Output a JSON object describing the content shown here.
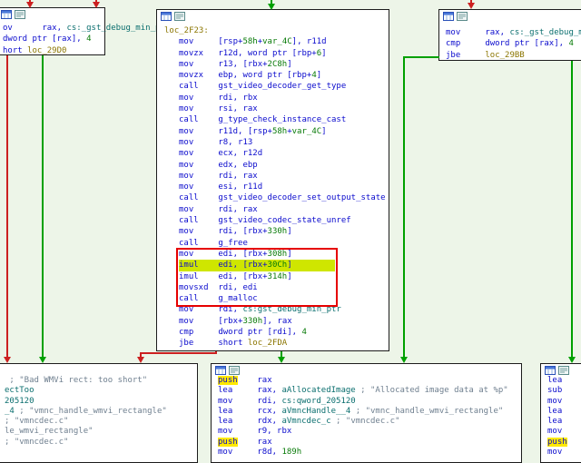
{
  "app": "disassembler-graph-view",
  "colors": {
    "canvas_bg": "#edf5e8",
    "node_bg": "#ffffff",
    "node_border": "#1c1c1c",
    "code_blue": "#0b0bcd",
    "number_green": "#087a08",
    "dataref_teal": "#0a6e6e",
    "loc_label_olive": "#8b7500",
    "comment_slate": "#708090",
    "edge_green": "#00a000",
    "edge_red": "#cc2020",
    "highlight_box_red": "#e60000",
    "highlight_line_lime": "#cfe600",
    "highlight_word_yellow": "#ffe900"
  },
  "blocks": {
    "top_left": {
      "lines": [
        [
          [
            "b",
            "ov      rax, "
          ],
          [
            "d",
            "cs:_gst_debug_min_ptr"
          ]
        ],
        [
          [
            "b",
            "dword ptr [rax], "
          ],
          [
            "n",
            "4"
          ]
        ],
        [
          [
            "b",
            "hort "
          ],
          [
            "l",
            "loc_29D0"
          ]
        ]
      ]
    },
    "center": {
      "lines": [
        {
          "cls": "label",
          "segs": [
            [
              "l",
              "loc_2F23:"
            ]
          ]
        },
        [
          [
            "b",
            "mov     [rsp+"
          ],
          [
            "n",
            "58h"
          ],
          [
            "b",
            "+"
          ],
          [
            "n",
            "var_4C"
          ],
          [
            "b",
            "], r11d"
          ]
        ],
        [
          [
            "b",
            "movzx   r12d, word ptr [rbp+"
          ],
          [
            "n",
            "6"
          ],
          [
            "b",
            "]"
          ]
        ],
        [
          [
            "b",
            "mov     r13, [rbx+"
          ],
          [
            "n",
            "2C8h"
          ],
          [
            "b",
            "]"
          ]
        ],
        [
          [
            "b",
            "movzx   ebp, word ptr [rbp+"
          ],
          [
            "n",
            "4"
          ],
          [
            "b",
            "]"
          ]
        ],
        [
          [
            "b",
            "call    "
          ],
          [
            "f",
            "gst_video_decoder_get_type"
          ]
        ],
        [
          [
            "b",
            "mov     rdi, rbx"
          ]
        ],
        [
          [
            "b",
            "mov     rsi, rax"
          ]
        ],
        [
          [
            "b",
            "call    "
          ],
          [
            "f",
            "g_type_check_instance_cast"
          ]
        ],
        [
          [
            "b",
            "mov     r11d, [rsp+"
          ],
          [
            "n",
            "58h"
          ],
          [
            "b",
            "+"
          ],
          [
            "n",
            "var_4C"
          ],
          [
            "b",
            "]"
          ]
        ],
        [
          [
            "b",
            "mov     r8, r13"
          ]
        ],
        [
          [
            "b",
            "mov     ecx, r12d"
          ]
        ],
        [
          [
            "b",
            "mov     edx, ebp"
          ]
        ],
        [
          [
            "b",
            "mov     rdi, rax"
          ]
        ],
        [
          [
            "b",
            "mov     esi, r11d"
          ]
        ],
        [
          [
            "b",
            "call    "
          ],
          [
            "f",
            "gst_video_decoder_set_output_state"
          ]
        ],
        [
          [
            "b",
            "mov     rdi, rax"
          ]
        ],
        [
          [
            "b",
            "call    "
          ],
          [
            "f",
            "gst_video_codec_state_unref"
          ]
        ],
        [
          [
            "b",
            "mov     rdi, [rbx+"
          ],
          [
            "n",
            "330h"
          ],
          [
            "b",
            "]"
          ]
        ],
        [
          [
            "b",
            "call    "
          ],
          [
            "f",
            "g_free"
          ]
        ],
        [
          [
            "b",
            "mov     edi, [rbx+"
          ],
          [
            "n",
            "308h"
          ],
          [
            "b",
            "]"
          ]
        ],
        {
          "cls": "lime",
          "segs": [
            [
              "b",
              "imul    edi, [rbx+"
            ],
            [
              "n",
              "30Ch"
            ],
            [
              "b",
              "]"
            ]
          ]
        },
        [
          [
            "b",
            "imul    edi, [rbx+"
          ],
          [
            "n",
            "314h"
          ],
          [
            "b",
            "]"
          ]
        ],
        [
          [
            "b",
            "movsxd  rdi, edi"
          ]
        ],
        [
          [
            "b",
            "call    "
          ],
          [
            "f",
            "g_malloc"
          ]
        ],
        [
          [
            "b",
            "mov     rdi, "
          ],
          [
            "d",
            "cs:gst_debug_min_ptr"
          ]
        ],
        [
          [
            "b",
            "mov     [rbx+"
          ],
          [
            "n",
            "330h"
          ],
          [
            "b",
            "], rax"
          ]
        ],
        [
          [
            "b",
            "cmp     dword ptr [rdi], "
          ],
          [
            "n",
            "4"
          ]
        ],
        [
          [
            "b",
            "jbe     short "
          ],
          [
            "l",
            "loc_2FDA"
          ]
        ]
      ]
    },
    "top_right": {
      "lines": [
        [
          [
            "b",
            "mov     rax, "
          ],
          [
            "d",
            "cs:_gst_debug_min_ptr"
          ]
        ],
        [
          [
            "b",
            "cmp     dword ptr [rax], "
          ],
          [
            "n",
            "4"
          ]
        ],
        [
          [
            "b",
            "jbe     "
          ],
          [
            "l",
            "loc_29BB"
          ]
        ]
      ]
    },
    "bottom_left": {
      "lines": [
        [
          [
            "c",
            " ; \"Bad WMVi rect: too short\""
          ]
        ],
        [
          [
            "d",
            "ectToo"
          ]
        ],
        [
          [
            "d",
            "205120"
          ]
        ],
        [
          [
            "d",
            "_4"
          ],
          [
            "c",
            " ; \"vmnc_handle_wmvi_rectangle\""
          ]
        ],
        [
          [
            "c",
            "; \"vmncdec.c\""
          ]
        ],
        [
          [
            "c",
            "le_wmvi_rectangle\""
          ]
        ],
        [
          [
            "c",
            "; \"vmncdec.c\""
          ]
        ]
      ]
    },
    "bottom_center": {
      "lines": [
        [
          [
            "hy",
            "push"
          ],
          [
            "b",
            "    rax"
          ]
        ],
        [
          [
            "b",
            "lea     rax, "
          ],
          [
            "d",
            "aAllocatedImage"
          ],
          [
            "c",
            " ; \"Allocated image data at %p\""
          ]
        ],
        [
          [
            "b",
            "mov     rdi, "
          ],
          [
            "d",
            "cs:qword_205120"
          ]
        ],
        [
          [
            "b",
            "lea     rcx, "
          ],
          [
            "d",
            "aVmncHandle__4"
          ],
          [
            "c",
            " ; \"vmnc_handle_wmvi_rectangle\""
          ]
        ],
        [
          [
            "b",
            "lea     rdx, "
          ],
          [
            "d",
            "aVmncdec_c"
          ],
          [
            "c",
            " ; \"vmncdec.c\""
          ]
        ],
        [
          [
            "b",
            "mov     r9, rbx"
          ]
        ],
        [
          [
            "hy",
            "push"
          ],
          [
            "b",
            "    rax"
          ]
        ],
        [
          [
            "b",
            "mov     r8d, "
          ],
          [
            "n",
            "189h"
          ]
        ]
      ]
    },
    "bottom_right": {
      "lines": [
        [
          [
            "b",
            "lea     r"
          ]
        ],
        [
          [
            "b",
            "sub     r"
          ]
        ],
        [
          [
            "b",
            "mov     r"
          ]
        ],
        [
          [
            "b",
            "lea     r"
          ]
        ],
        [
          [
            "b",
            "lea     r"
          ]
        ],
        [
          [
            "b",
            "mov     r"
          ]
        ],
        [
          [
            "hy",
            "push"
          ],
          [
            "b",
            "    r"
          ]
        ],
        [
          [
            "b",
            "mov     r"
          ]
        ]
      ]
    }
  }
}
